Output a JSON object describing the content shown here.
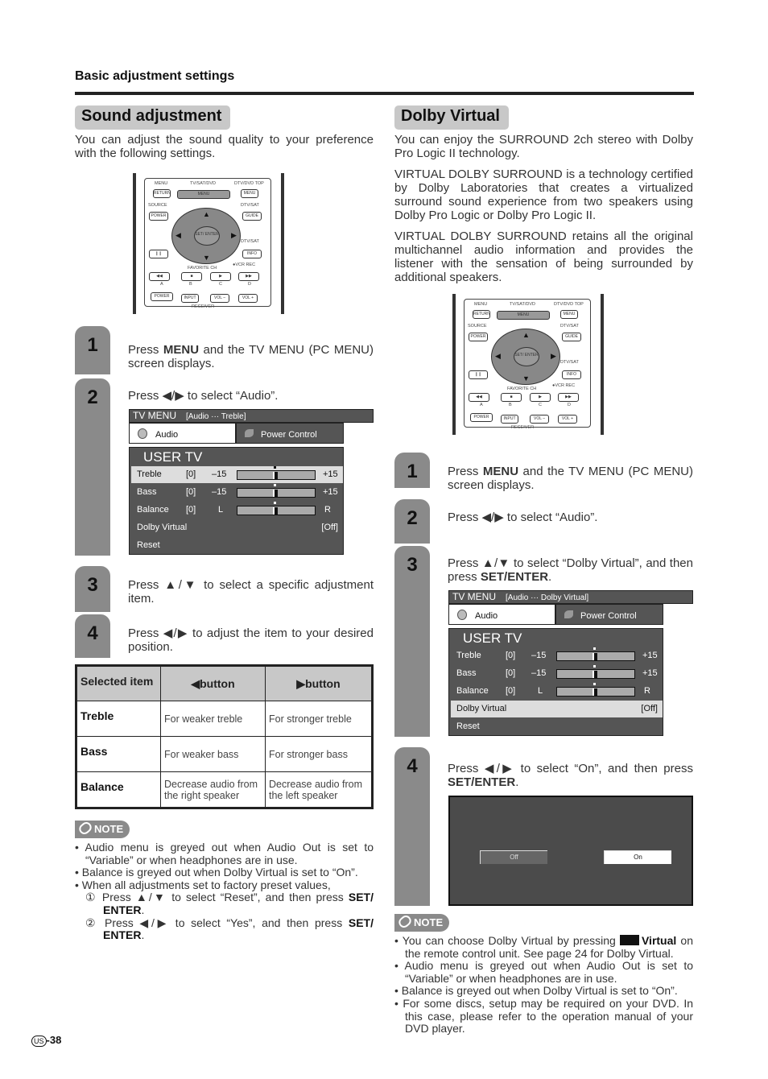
{
  "header": {
    "section": "Basic adjustment settings"
  },
  "left": {
    "title": "Sound adjustment",
    "intro": "You can adjust the sound quality to your preference with the following settings.",
    "steps": [
      {
        "num": "1",
        "pre": "Press ",
        "bold": "MENU",
        "post": " and the TV MENU (PC MENU) screen displays."
      },
      {
        "num": "2",
        "pre": "Press ◀/▶ to select “Audio”.",
        "bold": "",
        "post": ""
      },
      {
        "num": "3",
        "pre": "Press ▲/▼ to select a specific adjustment item.",
        "bold": "",
        "post": ""
      },
      {
        "num": "4",
        "pre": "Press ◀/▶ to adjust the item to your desired position.",
        "bold": "",
        "post": ""
      }
    ],
    "table": {
      "headers": [
        "Selected item",
        "◀button",
        "▶button"
      ],
      "rows": [
        [
          "Treble",
          "For weaker treble",
          "For stronger treble"
        ],
        [
          "Bass",
          "For weaker bass",
          "For stronger bass"
        ],
        [
          "Balance",
          "Decrease audio from the right speaker",
          "Decrease audio from the left speaker"
        ]
      ]
    },
    "note_label": "NOTE",
    "notes": [
      "Audio menu is greyed out when Audio Out is set to “Variable” or when headphones are in use.",
      "Balance is greyed out when Dolby Virtual is set to “On”.",
      "When all adjustments set to factory preset values,"
    ],
    "substeps": [
      {
        "num": "①",
        "text": "Press ▲/▼ to select “Reset”, and then press ",
        "bold": "SET/ ENTER",
        "end": "."
      },
      {
        "num": "②",
        "text": "Press ◀/▶ to select “Yes”, and then press ",
        "bold": "SET/ ENTER",
        "end": "."
      }
    ]
  },
  "right": {
    "title": "Dolby Virtual",
    "paras": [
      "You can enjoy the SURROUND 2ch stereo with Dolby Pro Logic II technology.",
      "VIRTUAL DOLBY SURROUND is a technology certified by Dolby Laboratories that creates a virtualized surround sound experience from two speakers using Dolby Pro Logic or Dolby Pro Logic II.",
      "VIRTUAL DOLBY SURROUND retains all the original multichannel audio information and provides the listener with the sensation of being surrounded by additional speakers."
    ],
    "steps": [
      {
        "num": "1",
        "pre": "Press ",
        "bold": "MENU",
        "post": " and the TV MENU (PC MENU) screen displays."
      },
      {
        "num": "2",
        "pre": "Press ◀/▶ to select “Audio”.",
        "bold": "",
        "post": ""
      },
      {
        "num": "3",
        "pre": "Press ▲/▼ to select “Dolby Virtual”, and then press ",
        "bold": "SET/ENTER",
        "post": "."
      },
      {
        "num": "4",
        "pre": "Press ◀/▶ to select “On”, and then press ",
        "bold": "SET/ENTER",
        "post": "."
      }
    ],
    "dialog": {
      "off": "Off",
      "on": "On",
      "selected": "On"
    },
    "note_label": "NOTE",
    "notes": [
      {
        "pre": "You can choose Dolby Virtual by pressing ",
        "bold": "Virtual",
        "post": " on the remote control unit. See page 24 for Dolby Virtual."
      },
      {
        "pre": "Audio menu is greyed out when Audio Out is set to “Variable” or when headphones are in use.",
        "bold": "",
        "post": ""
      },
      {
        "pre": "Balance is greyed out when Dolby Virtual is set to “On”.",
        "bold": "",
        "post": ""
      },
      {
        "pre": "For some discs, setup may be required on your DVD. In this case, please refer to the operation manual of your DVD player.",
        "bold": "",
        "post": ""
      }
    ]
  },
  "remote": {
    "menu": "MENU",
    "return": "RETURN",
    "tvsatdvd": "TV/SAT/DVD",
    "menu_btn": "MENU",
    "dtvdvdtop": "DTV/DVD TOP",
    "menu2": "MENU",
    "source": "SOURCE",
    "power": "POWER",
    "dtvsat": "DTV/SAT",
    "guide": "GUIDE",
    "set_enter": "SET/ ENTER",
    "dtvsat2": "DTV/SAT",
    "info": "INFO",
    "favorite": "FAVORITE CH",
    "vcrrec": "●VCR REC",
    "a": "A",
    "b": "B",
    "c": "C",
    "d": "D",
    "power2": "POWER",
    "input": "INPUT",
    "voldown": "VOL –",
    "volup": "VOL +",
    "receiver": "RECEIVER"
  },
  "tvmenu": {
    "title": "TV MENU",
    "audio": "Audio",
    "power_control": "Power Control",
    "user": "USER TV",
    "crumb_left": "[Audio ··· Treble]",
    "crumb_right": "[Audio ··· Dolby Virtual]",
    "rows": [
      {
        "label": "Treble",
        "val": "[0]",
        "min": "–15",
        "max": "+15",
        "level": 0
      },
      {
        "label": "Bass",
        "val": "[0]",
        "min": "–15",
        "max": "+15",
        "level": 0
      },
      {
        "label": "Balance",
        "val": "[0]",
        "min": "L",
        "max": "R",
        "level": 0
      },
      {
        "label": "Dolby Virtual",
        "state": "[Off]"
      },
      {
        "label": "Reset"
      }
    ]
  },
  "footer": {
    "region": "US",
    "page": "-38"
  }
}
